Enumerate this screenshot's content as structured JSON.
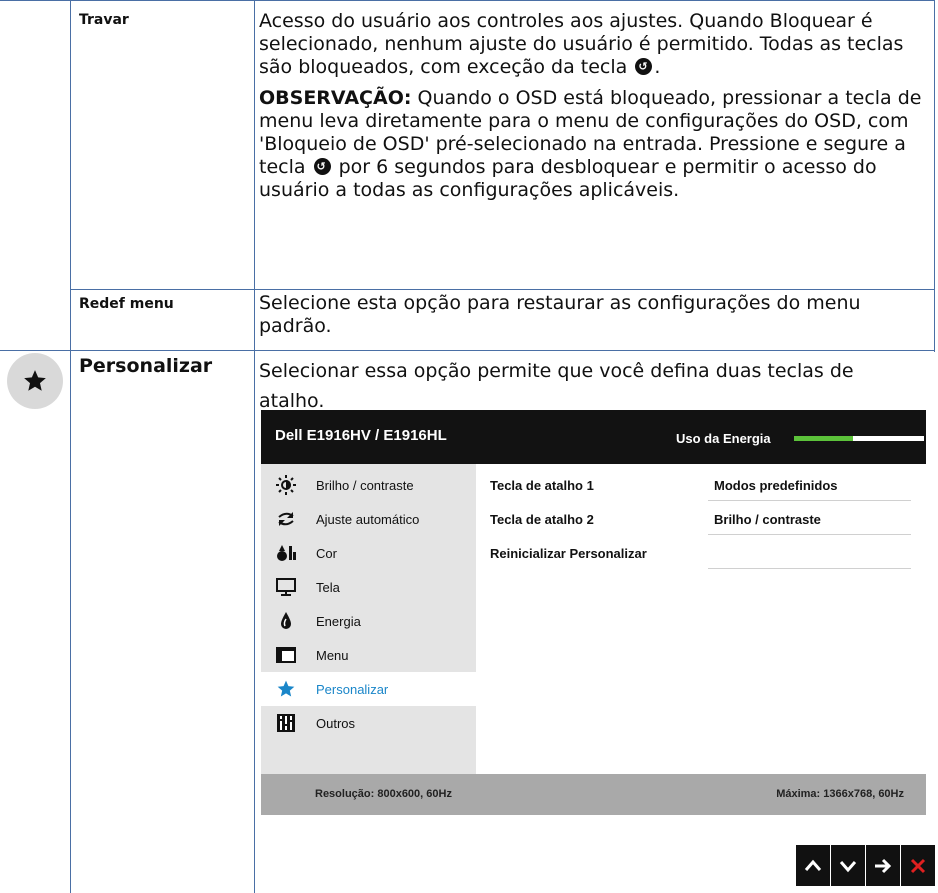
{
  "rows": [
    {
      "label": "Travar",
      "paragraphs": [
        {
          "segments": [
            "Acesso do usuário aos controles aos ajustes. Quando Bloquear é selecionado, nenhum ajuste do usuário é permitido. Todas as teclas são bloqueados, com exceção da tecla ",
            "."
          ]
        },
        {
          "bold_lead": "OBSERVAÇÃO:",
          "segments": [
            " Quando o OSD está bloqueado, pressionar a tecla de menu leva diretamente para o menu de configurações do OSD, com 'Bloqueio de OSD' pré-selecionado na entrada. Pressione e segure a tecla ",
            " por 6 segundos para desbloquear e permitir o acesso do usuário a todas as configurações aplicáveis."
          ]
        }
      ]
    },
    {
      "label": "Redef menu",
      "text": "Selecione esta opção para restaurar as configurações do menu padrão."
    },
    {
      "label": "Personalizar",
      "icon": "star-icon",
      "text": "Selecionar essa opção permite que você defina duas teclas de atalho."
    }
  ],
  "osd": {
    "title": "Dell E1916HV / E1916HL",
    "energy_label": "Uso da Energia",
    "energy_level": 0.45,
    "energy_color": "#5cc23a",
    "menu": [
      {
        "label": "Brilho / contraste",
        "icon": "sun-icon"
      },
      {
        "label": "Ajuste automático",
        "icon": "auto-adjust-icon"
      },
      {
        "label": "Cor",
        "icon": "color-icon"
      },
      {
        "label": "Tela",
        "icon": "monitor-icon"
      },
      {
        "label": "Energia",
        "icon": "power-drop-icon"
      },
      {
        "label": "Menu",
        "icon": "menu-window-icon"
      },
      {
        "label": "Personalizar",
        "icon": "star-icon",
        "active": true
      },
      {
        "label": "Outros",
        "icon": "sliders-icon"
      }
    ],
    "submenu": [
      {
        "label": "Tecla de atalho 1",
        "value": "Modos predefinidos"
      },
      {
        "label": "Tecla de atalho 2",
        "value": "Brilho / contraste"
      },
      {
        "label": "Reinicializar Personalizar",
        "value": ""
      }
    ],
    "footer_left": "Resolução: 800x600, 60Hz",
    "footer_right": "Máxima: 1366x768, 60Hz",
    "active_color": "#1a86c9"
  },
  "nav_keys": [
    "up-arrow-icon",
    "down-arrow-icon",
    "right-arrow-icon",
    "close-icon"
  ]
}
